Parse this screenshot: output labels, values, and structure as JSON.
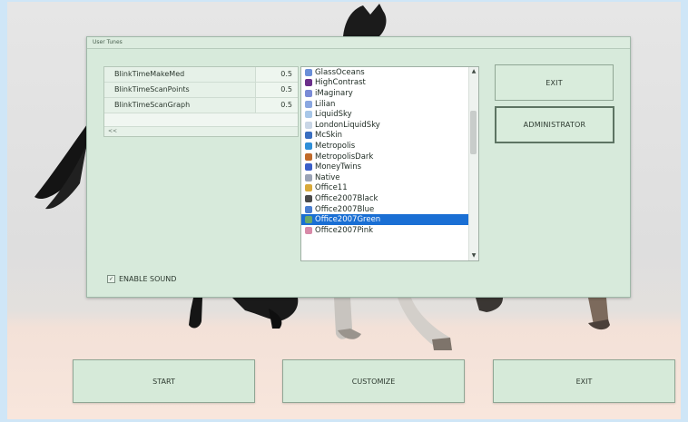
{
  "dialog": {
    "title": "User Tunes",
    "grid": {
      "rows": [
        {
          "name": "BlinkTimeMakeMed",
          "value": "0.5"
        },
        {
          "name": "BlinkTimeScanPoints",
          "value": "0.5"
        },
        {
          "name": "BlinkTimeScanGraph",
          "value": "0.5"
        }
      ],
      "footer": "<<"
    },
    "skins": [
      {
        "label": "GlassOceans",
        "color": "#6a8fd8"
      },
      {
        "label": "HighContrast",
        "color": "#6b2f8a"
      },
      {
        "label": "iMaginary",
        "color": "#7a8bd6"
      },
      {
        "label": "Lilian",
        "color": "#8aa7e0"
      },
      {
        "label": "LiquidSky",
        "color": "#a8c7e8"
      },
      {
        "label": "LondonLiquidSky",
        "color": "#c9d6e6"
      },
      {
        "label": "McSkin",
        "color": "#3a6fc0"
      },
      {
        "label": "Metropolis",
        "color": "#2f8fd8"
      },
      {
        "label": "MetropolisDark",
        "color": "#c06a2a"
      },
      {
        "label": "MoneyTwins",
        "color": "#3a5fc8"
      },
      {
        "label": "Native",
        "color": "#9aa3b5"
      },
      {
        "label": "Office11",
        "color": "#d8a93a"
      },
      {
        "label": "Office2007Black",
        "color": "#4a4a4a"
      },
      {
        "label": "Office2007Blue",
        "color": "#4a7ed0"
      },
      {
        "label": "Office2007Green",
        "color": "#6aa86a"
      },
      {
        "label": "Office2007Pink",
        "color": "#d88aa8"
      }
    ],
    "selected_skin": "Office2007Green",
    "exit_label": "EXIT",
    "admin_label": "ADMINISTRATOR",
    "sound_label": "ENABLE SOUND",
    "sound_check": "✓"
  },
  "bottom": {
    "start_label": "START",
    "customize_label": "CUSTOMIZE",
    "exit_label": "EXIT"
  },
  "colors": {
    "dialog_bg": "#d7eadb",
    "selection": "#1a6fd4",
    "frame": "#cfe6f7"
  }
}
